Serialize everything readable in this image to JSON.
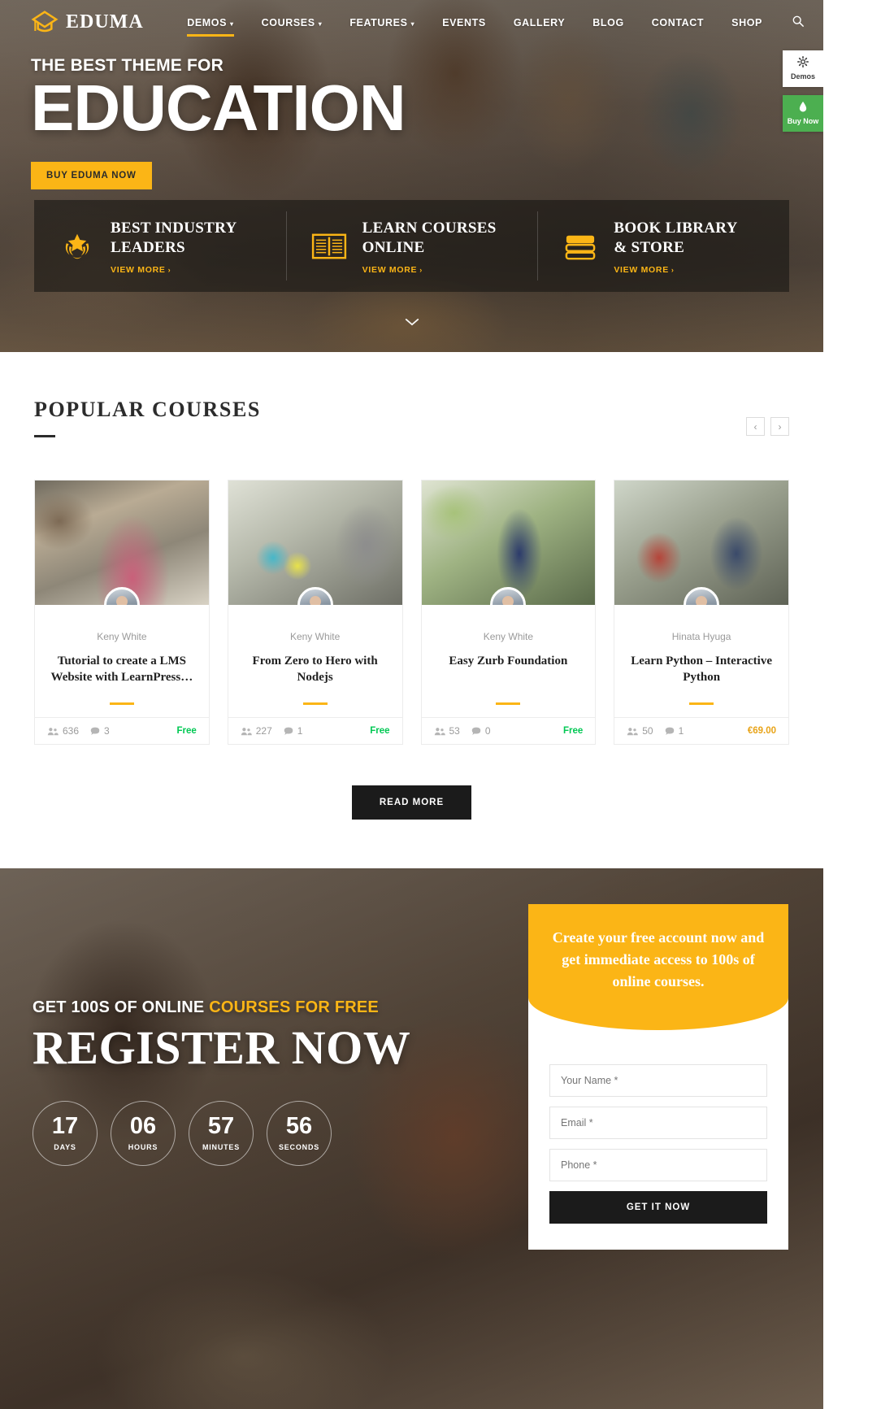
{
  "brand": {
    "name": "EDUMA",
    "logo_icon": "graduation-cap-icon",
    "accent": "#fbb516"
  },
  "nav": {
    "items": [
      {
        "label": "DEMOS",
        "caret": "▾",
        "active": true
      },
      {
        "label": "COURSES",
        "caret": "▾",
        "active": false
      },
      {
        "label": "FEATURES",
        "caret": "▾",
        "active": false
      },
      {
        "label": "EVENTS",
        "caret": "",
        "active": false
      },
      {
        "label": "GALLERY",
        "caret": "",
        "active": false
      },
      {
        "label": "BLOG",
        "caret": "",
        "active": false
      },
      {
        "label": "CONTACT",
        "caret": "",
        "active": false
      },
      {
        "label": "SHOP",
        "caret": "",
        "active": false
      }
    ],
    "search_icon": "search-icon"
  },
  "hero": {
    "kicker": "THE BEST THEME FOR",
    "title": "EDUCATION",
    "cta": "BUY EDUMA NOW",
    "scroll_icon": "chevron-down-icon"
  },
  "features": [
    {
      "icon": "laurel-star-icon",
      "title_line1": "BEST INDUSTRY",
      "title_line2": "LEADERS",
      "link": "VIEW MORE",
      "arrow": "›"
    },
    {
      "icon": "open-book-icon",
      "title_line1": "LEARN COURSES",
      "title_line2": "ONLINE",
      "link": "VIEW MORE",
      "arrow": "›"
    },
    {
      "icon": "book-stack-icon",
      "title_line1": "BOOK LIBRARY",
      "title_line2": "& STORE",
      "link": "VIEW MORE",
      "arrow": "›"
    }
  ],
  "courses_section": {
    "title": "POPULAR COURSES",
    "prev_label": "‹",
    "next_label": "›",
    "read_more": "READ MORE",
    "cards": [
      {
        "author": "Keny White",
        "title": "Tutorial to create a LMS Website with LearnPress…",
        "students": "636",
        "comments": "3",
        "price": "Free",
        "price_type": "free"
      },
      {
        "author": "Keny White",
        "title": "From Zero to Hero with Nodejs",
        "students": "227",
        "comments": "1",
        "price": "Free",
        "price_type": "free"
      },
      {
        "author": "Keny White",
        "title": "Easy Zurb Foundation",
        "students": "53",
        "comments": "0",
        "price": "Free",
        "price_type": "free"
      },
      {
        "author": "Hinata Hyuga",
        "title": "Learn Python – Interactive Python",
        "students": "50",
        "comments": "1",
        "price": "€69.00",
        "price_type": "paid"
      }
    ]
  },
  "register": {
    "kicker_plain": "GET 100S OF ONLINE ",
    "kicker_highlight": "COURSES FOR FREE",
    "title": "REGISTER NOW",
    "countdown": [
      {
        "value": "17",
        "label": "DAYS"
      },
      {
        "value": "06",
        "label": "HOURS"
      },
      {
        "value": "57",
        "label": "MINUTES"
      },
      {
        "value": "56",
        "label": "SECONDS"
      }
    ],
    "card_heading": "Create your free account now and get immediate access to 100s of online courses.",
    "fields": [
      {
        "name": "your-name",
        "placeholder": "Your Name *"
      },
      {
        "name": "email",
        "placeholder": "Email *"
      },
      {
        "name": "phone",
        "placeholder": "Phone *"
      }
    ],
    "submit": "GET IT NOW"
  },
  "floating": {
    "demos": {
      "label": "Demos",
      "icon": "gear-icon"
    },
    "buy": {
      "label": "Buy Now",
      "icon": "drop-icon",
      "color": "#4caf50"
    }
  }
}
